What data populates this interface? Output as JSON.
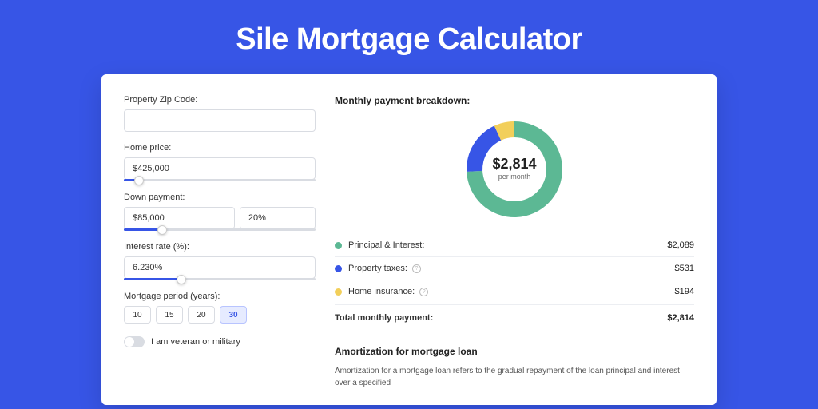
{
  "page_title": "Sile Mortgage Calculator",
  "form": {
    "zip_label": "Property Zip Code:",
    "zip_value": "",
    "home_price_label": "Home price:",
    "home_price_value": "$425,000",
    "home_price_slider_pct": 8,
    "down_payment_label": "Down payment:",
    "down_payment_value": "$85,000",
    "down_payment_pct_value": "20%",
    "down_payment_slider_pct": 20,
    "interest_label": "Interest rate (%):",
    "interest_value": "6.230%",
    "interest_slider_pct": 30,
    "period_label": "Mortgage period (years):",
    "period_options": [
      "10",
      "15",
      "20",
      "30"
    ],
    "period_selected": "30",
    "veteran_label": "I am veteran or military",
    "veteran_on": false
  },
  "breakdown": {
    "title": "Monthly payment breakdown:",
    "donut_total": "$2,814",
    "donut_sub": "per month",
    "items": [
      {
        "label": "Principal & Interest:",
        "value": "$2,089",
        "color": "#5cb894",
        "info": false,
        "num": 2089
      },
      {
        "label": "Property taxes:",
        "value": "$531",
        "color": "#3755e6",
        "info": true,
        "num": 531
      },
      {
        "label": "Home insurance:",
        "value": "$194",
        "color": "#f2cf5a",
        "info": true,
        "num": 194
      }
    ],
    "total_label": "Total monthly payment:",
    "total_value": "$2,814"
  },
  "chart_data": {
    "type": "pie",
    "title": "Monthly payment breakdown",
    "categories": [
      "Principal & Interest",
      "Property taxes",
      "Home insurance"
    ],
    "values": [
      2089,
      531,
      194
    ],
    "colors": [
      "#5cb894",
      "#3755e6",
      "#f2cf5a"
    ],
    "center_label": "$2,814 per month"
  },
  "amortization": {
    "title": "Amortization for mortgage loan",
    "text": "Amortization for a mortgage loan refers to the gradual repayment of the loan principal and interest over a specified"
  }
}
